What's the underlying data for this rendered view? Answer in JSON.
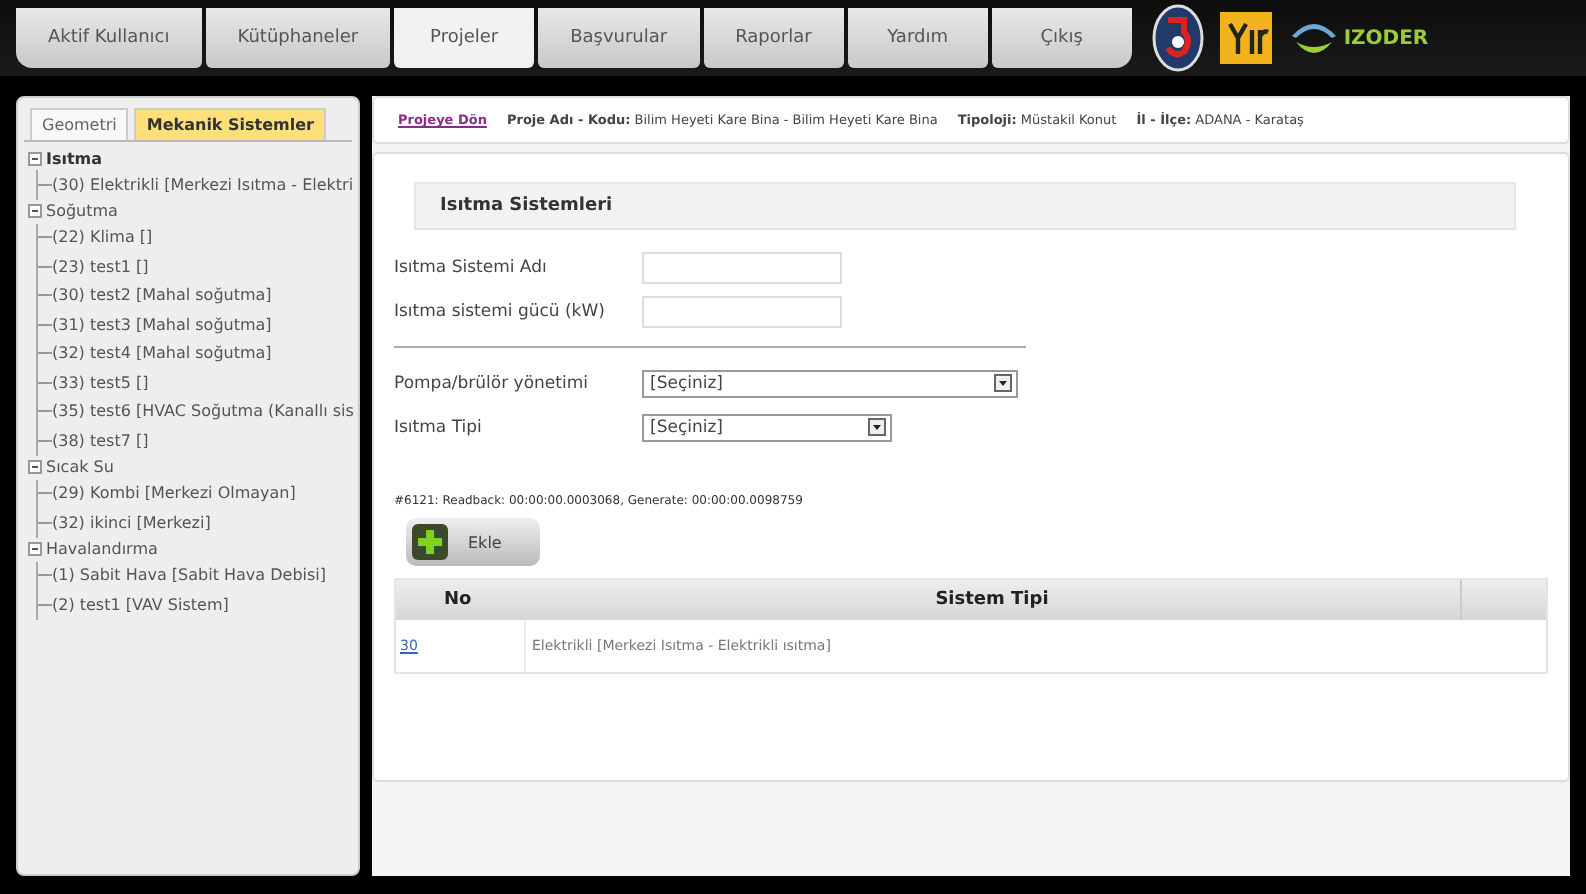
{
  "tabs": [
    {
      "label": "Aktif Kullanıcı",
      "selected": false
    },
    {
      "label": "Kütüphaneler",
      "selected": false
    },
    {
      "label": "Projeler",
      "selected": true
    },
    {
      "label": "Başvurular",
      "selected": false
    },
    {
      "label": "Raporlar",
      "selected": false
    },
    {
      "label": "Yardım",
      "selected": false
    },
    {
      "label": "Çıkış",
      "selected": false
    }
  ],
  "brand": "IZODER",
  "side_tabs": [
    {
      "label": "Geometri",
      "selected": false
    },
    {
      "label": "Mekanik Sistemler",
      "selected": true
    }
  ],
  "tree": [
    {
      "label": "Isıtma",
      "expanded": true,
      "selected": true,
      "children": [
        {
          "label": "(30) Elektrikli [Merkezi Isıtma - Elektri"
        }
      ]
    },
    {
      "label": "Soğutma",
      "expanded": true,
      "selected": false,
      "children": [
        {
          "label": "(22) Klima []"
        },
        {
          "label": "(23) test1 []"
        },
        {
          "label": "(30) test2 [Mahal soğutma]"
        },
        {
          "label": "(31) test3 [Mahal soğutma]"
        },
        {
          "label": "(32) test4 [Mahal soğutma]"
        },
        {
          "label": "(33) test5 []"
        },
        {
          "label": "(35) test6 [HVAC Soğutma (Kanallı sis"
        },
        {
          "label": "(38) test7 []"
        }
      ]
    },
    {
      "label": "Sıcak Su",
      "expanded": true,
      "selected": false,
      "children": [
        {
          "label": "(29) Kombi [Merkezi Olmayan]"
        },
        {
          "label": "(32) ikinci [Merkezi]"
        }
      ]
    },
    {
      "label": "Havalandırma",
      "expanded": true,
      "selected": false,
      "children": [
        {
          "label": "(1) Sabit Hava [Sabit Hava Debisi]"
        },
        {
          "label": "(2) test1 [VAV Sistem]"
        }
      ]
    }
  ],
  "info_bar": {
    "back_link": "Projeye Dön",
    "items": [
      "**Proje Adı - Kodu:** Bilim Heyeti Kare Bina - Bilim Heyeti Kare Bina",
      "**Tipoloji:** Müstakil Konut",
      "**İl - İlçe:** ADANA - Karataş"
    ]
  },
  "section_title": "Isıtma Sistemleri",
  "fields": [
    {
      "kind": "text",
      "label": "Isıtma Sistemi Adı"
    },
    {
      "kind": "text",
      "label": "Isıtma sistemi gücü (kW)"
    },
    {
      "kind": "divider"
    },
    {
      "kind": "select",
      "label": "Pompa/brülör yönetimi",
      "value": "[Seçiniz]",
      "wide": true
    },
    {
      "kind": "select",
      "label": "Isıtma Tipi",
      "value": "[Seçiniz]",
      "wide": false
    }
  ],
  "timing": "#6121: Readback: 00:00:00.0003068, Generate: 00:00:00.0098759",
  "add_button": "Ekle",
  "table": {
    "columns": [
      "No",
      "Sistem Tipi"
    ],
    "rows": [
      [
        "30",
        "Elektrikli [Merkezi Isıtma - Elektrikli ısıtma]"
      ]
    ]
  }
}
